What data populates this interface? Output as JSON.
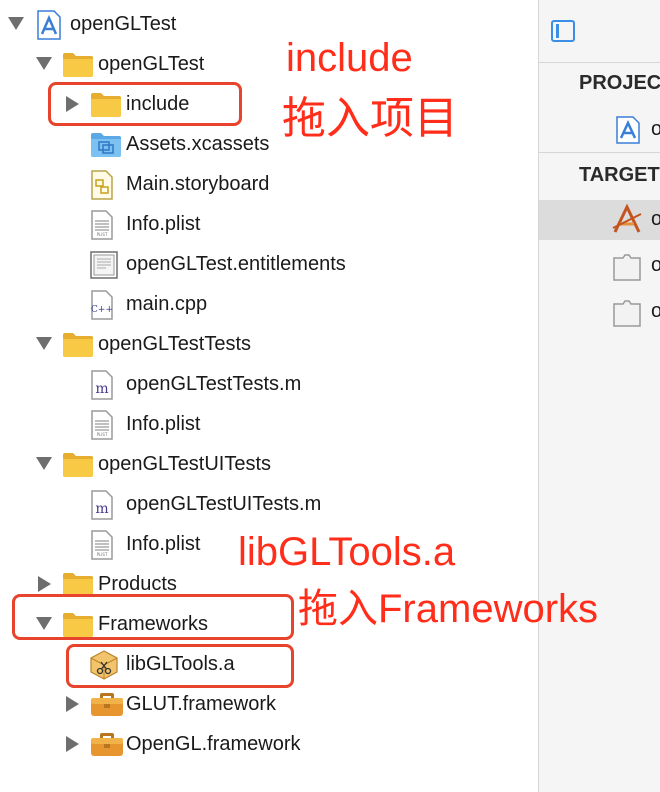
{
  "navigator": {
    "rows": [
      {
        "label": "openGLTest",
        "icon": "xcode-project-icon",
        "disclosure": "expanded"
      },
      {
        "label": "openGLTest",
        "icon": "folder-icon",
        "disclosure": "expanded"
      },
      {
        "label": "include",
        "icon": "folder-icon",
        "disclosure": "collapsed"
      },
      {
        "label": "Assets.xcassets",
        "icon": "asset-catalog-icon",
        "disclosure": "none"
      },
      {
        "label": "Main.storyboard",
        "icon": "storyboard-icon",
        "disclosure": "none"
      },
      {
        "label": "Info.plist",
        "icon": "plist-icon",
        "disclosure": "none"
      },
      {
        "label": "openGLTest.entitlements",
        "icon": "entitlements-icon",
        "disclosure": "none"
      },
      {
        "label": "main.cpp",
        "icon": "cpp-file-icon",
        "disclosure": "none"
      },
      {
        "label": "openGLTestTests",
        "icon": "folder-icon",
        "disclosure": "expanded"
      },
      {
        "label": "openGLTestTests.m",
        "icon": "objc-file-icon",
        "disclosure": "none"
      },
      {
        "label": "Info.plist",
        "icon": "plist-icon",
        "disclosure": "none"
      },
      {
        "label": "openGLTestUITests",
        "icon": "folder-icon",
        "disclosure": "expanded"
      },
      {
        "label": "openGLTestUITests.m",
        "icon": "objc-file-icon",
        "disclosure": "none"
      },
      {
        "label": "Info.plist",
        "icon": "plist-icon",
        "disclosure": "none"
      },
      {
        "label": "Products",
        "icon": "folder-icon",
        "disclosure": "collapsed"
      },
      {
        "label": "Frameworks",
        "icon": "folder-icon",
        "disclosure": "expanded"
      },
      {
        "label": "libGLTools.a",
        "icon": "static-library-icon",
        "disclosure": "none"
      },
      {
        "label": "GLUT.framework",
        "icon": "framework-icon",
        "disclosure": "collapsed"
      },
      {
        "label": "OpenGL.framework",
        "icon": "framework-icon",
        "disclosure": "collapsed"
      }
    ]
  },
  "annotations": {
    "include_title": "include",
    "include_note": "拖入项目",
    "lib_title": "libGLTools.a",
    "lib_note": "拖入Frameworks"
  },
  "inspector": {
    "project_header": "PROJEC",
    "targets_header": "TARGET",
    "project_item": "o",
    "target_items": [
      "o",
      "o",
      "o"
    ]
  },
  "colors": {
    "folder": "#f7c945",
    "annotation": "#ff2d1a",
    "accent": "#3a8ee6"
  }
}
